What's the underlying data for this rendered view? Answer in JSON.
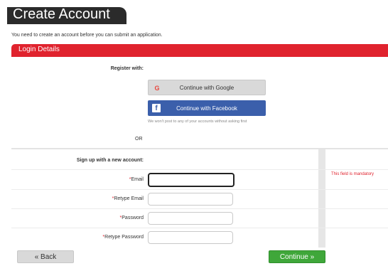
{
  "header": {
    "title": "Create Account"
  },
  "intro_text": "You need to create an account before you can submit an application.",
  "section": {
    "title": "Login Details"
  },
  "register": {
    "label": "Register with:",
    "google_label": "Continue with Google",
    "facebook_label": "Continue with Facebook",
    "notice": "We won't post to any of your accounts without asking first",
    "or_text": "OR"
  },
  "signup": {
    "label": "Sign up with a new account:",
    "fields": [
      {
        "label": "Email",
        "value": ""
      },
      {
        "label": "Retype Email",
        "value": ""
      },
      {
        "label": "Password",
        "value": ""
      },
      {
        "label": "Retype Password",
        "value": ""
      }
    ],
    "mandatory_msg": "This field is mandatory"
  },
  "footer": {
    "back_label": "« Back",
    "continue_label": "Continue »"
  },
  "colors": {
    "accent_red": "#e0232e",
    "facebook_blue": "#3b5fab",
    "continue_green": "#3fa73a",
    "title_dark": "#2b2b2b"
  },
  "icons": {
    "google": "google-icon",
    "facebook": "facebook-icon"
  }
}
